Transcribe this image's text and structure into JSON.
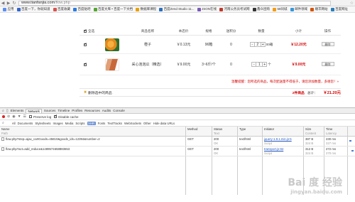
{
  "browser": {
    "url_host": "www.tianfanjia.com",
    "url_path": "/flow.php",
    "bookmarks": [
      {
        "label": "应用",
        "color": "#5b8def"
      },
      {
        "label": "百度一下，你就知道",
        "color": "#3366cc"
      },
      {
        "label": "百度收藏",
        "color": "#d9534f"
      },
      {
        "label": "百度贴吧",
        "color": "#2a7ae2"
      },
      {
        "label": "百度文库 • 百度一下文档",
        "color": "#55a532"
      },
      {
        "label": "数据库课程",
        "color": "#e8a000"
      },
      {
        "label": "百度Zend Studio 11...",
        "color": "#2c6fbf"
      },
      {
        "label": "JSON在线",
        "color": "#7a5ab8"
      },
      {
        "label": "河南公务员考试网",
        "color": "#c0392b"
      },
      {
        "label": "鑫众团购",
        "color": "#333333"
      },
      {
        "label": "58同城",
        "color": "#f39c12"
      },
      {
        "label": "邮件领域",
        "color": "#3498db"
      },
      {
        "label": "顺丰网站",
        "color": "#d35400"
      },
      {
        "label": "百度网址",
        "color": "#2980b9"
      }
    ]
  },
  "cart": {
    "headers": {
      "select_all": "全选",
      "name": "商品名称",
      "price": "本店价",
      "spec": "规格",
      "points": "送积分",
      "qty": "数量",
      "subtotal": "小计",
      "op": "操作"
    },
    "items": [
      {
        "name": "橙子",
        "price": "￥0.13元",
        "spec": "96箱",
        "points": "0",
        "qty": "2",
        "unit": "00箱",
        "subtotal": "￥12.20元",
        "del": "删除"
      },
      {
        "name": "采心泡泡瓜（精选）",
        "price": "￥9.00元",
        "spec": "3~6斤/个",
        "points": "0",
        "qty": "1",
        "unit": "个",
        "subtotal": "￥9.00元",
        "del": "删除"
      }
    ],
    "notice": "温馨提醒：您所选的商品，每次配送量不得低于，请您添加数量，多谢您！»",
    "footer": {
      "delete_selected": "删除选中的商品",
      "selected_count_label": "2件商品",
      "total_label": "总计：",
      "total_value": "￥21.20元"
    }
  },
  "devtools": {
    "tabs": [
      "Elements",
      "Network",
      "Sources",
      "Timeline",
      "Profiles",
      "Resources",
      "Audits",
      "Console"
    ],
    "active_tab": "Network",
    "toolbar": {
      "preserve_log": "Preserve log",
      "disable_cache": "Disable cache"
    },
    "filters": [
      "All",
      "Documents",
      "Stylesheets",
      "Images",
      "Media",
      "Scripts",
      "XHR",
      "Fonts",
      "TextTracks",
      "WebSockets",
      "Other",
      "Hide data URLs"
    ],
    "active_filter": "XHR",
    "columns": {
      "name": "Name",
      "name_sub": "Path",
      "method": "Method",
      "status": "Status",
      "status_sub": "Text",
      "type": "Type",
      "initiator": "Initiator",
      "size": "Size",
      "size_sub": "Content",
      "time": "Time",
      "time_sub": "Latency"
    },
    "requests": [
      {
        "name": "flow.php?step=ajax_cartGoods=45810&goods_ids=12394&number=2",
        "method": "GET",
        "status": "200",
        "status_sub": "OK",
        "type": "text/html",
        "initiator": "jquery-1.9.1.min.js:5",
        "initiator_sub": "Script",
        "size": "387 B",
        "size_sub": "324 B",
        "time": "230 ms",
        "time_sub": "227 ms"
      },
      {
        "name": "flow.php?act=add_reduce&1489574658883653",
        "method": "GET",
        "status": "200",
        "status_sub": "OK",
        "type": "text/html",
        "initiator": "transport.js:94",
        "initiator_sub": "Script",
        "size": "312 B",
        "size_sub": "324 B",
        "time": "272 ms",
        "time_sub": "270 ms"
      }
    ]
  },
  "watermark": {
    "brand": "Bai 度 经验",
    "sub": "jingyan.baidu.com"
  }
}
